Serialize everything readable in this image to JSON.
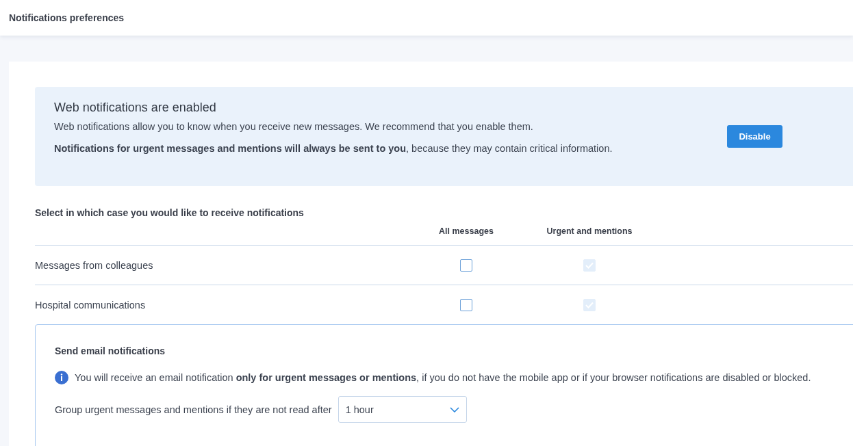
{
  "header": {
    "title": "Notifications preferences"
  },
  "banner": {
    "title": "Web notifications are enabled",
    "description": "Web notifications allow you to know when you receive new messages. We recommend that you enable them.",
    "note": "**Notifications for urgent messages and mentions will always be sent to you**, because they may contain critical information.",
    "button": "Disable"
  },
  "preferences": {
    "title": "Select in which case you would like to receive notifications",
    "columns": [
      "All messages",
      "Urgent and mentions"
    ],
    "rows": [
      {
        "label": "Messages from colleagues",
        "options": [
          {
            "checked": false,
            "disabled": false
          },
          {
            "checked": true,
            "disabled": true
          }
        ]
      },
      {
        "label": "Hospital communications",
        "options": [
          {
            "checked": false,
            "disabled": false
          },
          {
            "checked": true,
            "disabled": true
          }
        ]
      }
    ]
  },
  "email": {
    "title": "Send email notifications",
    "info": "You will receive an email notification **only for urgent messages or mentions**, if you do not have the mobile app or if your browser notifications are disabled or blocked.",
    "group_label": "Group urgent messages and mentions if they are not read after",
    "group_value": "1 hour"
  }
}
